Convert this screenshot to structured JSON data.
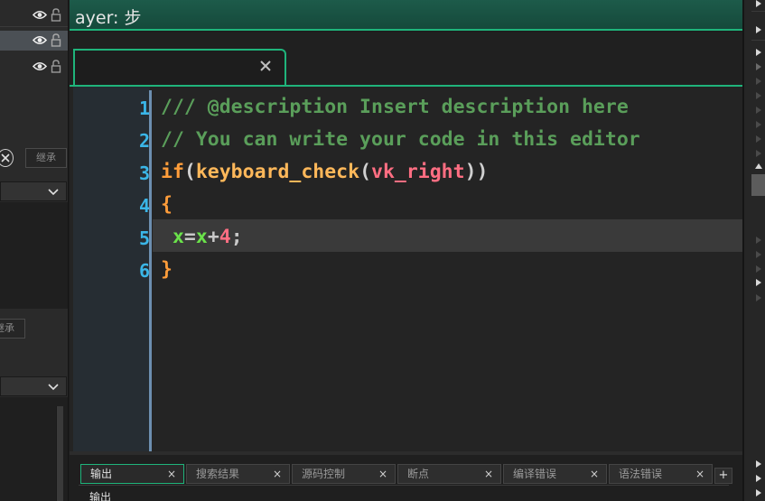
{
  "left_panel": {
    "layer_rows": [
      {
        "visibility_icon": "eye-icon",
        "lock_icon": "lock-icon",
        "selected": false
      },
      {
        "visibility_icon": "eye-icon",
        "lock_icon": "lock-icon",
        "selected": true
      },
      {
        "visibility_icon": "eye-icon",
        "lock_icon": "lock-icon",
        "selected": false
      }
    ],
    "inherit_button_label": "继承",
    "inherit_button2_label": "继承"
  },
  "title_bar": {
    "title": "ayer: 步"
  },
  "editor_tab": {
    "close_label": "×"
  },
  "code": {
    "line_numbers": [
      "1",
      "2",
      "3",
      "4",
      "5",
      "6"
    ],
    "line1": "/// @description Insert description here",
    "line2": "// You can write your code in this editor",
    "line3": {
      "kw": "if",
      "open": "(",
      "fn": "keyboard_check",
      "open2": "(",
      "const": "vk_right",
      "close": "))"
    },
    "line4": "{",
    "line5": {
      "indent": " ",
      "var1": "x",
      "op1": "=",
      "var2": "x",
      "op2": "+",
      "num": "4",
      "end": ";"
    },
    "line6": "}",
    "current_line": 5
  },
  "output_panel": {
    "tabs": [
      {
        "label": "输出",
        "close": "×",
        "active": true
      },
      {
        "label": "搜索结果",
        "close": "×",
        "active": false
      },
      {
        "label": "源码控制",
        "close": "×",
        "active": false
      },
      {
        "label": "断点",
        "close": "×",
        "active": false
      },
      {
        "label": "编译错误",
        "close": "×",
        "active": false
      },
      {
        "label": "语法错误",
        "close": "×",
        "active": false
      }
    ],
    "add_tab_label": "+",
    "output_title": "输出"
  },
  "colors": {
    "accent": "#1fb47b",
    "line_number": "#3ab6e8",
    "comment": "#5a9e5a",
    "keyword": "#ff9d3a",
    "constant": "#ff6e82",
    "variable": "#6ae24a"
  }
}
